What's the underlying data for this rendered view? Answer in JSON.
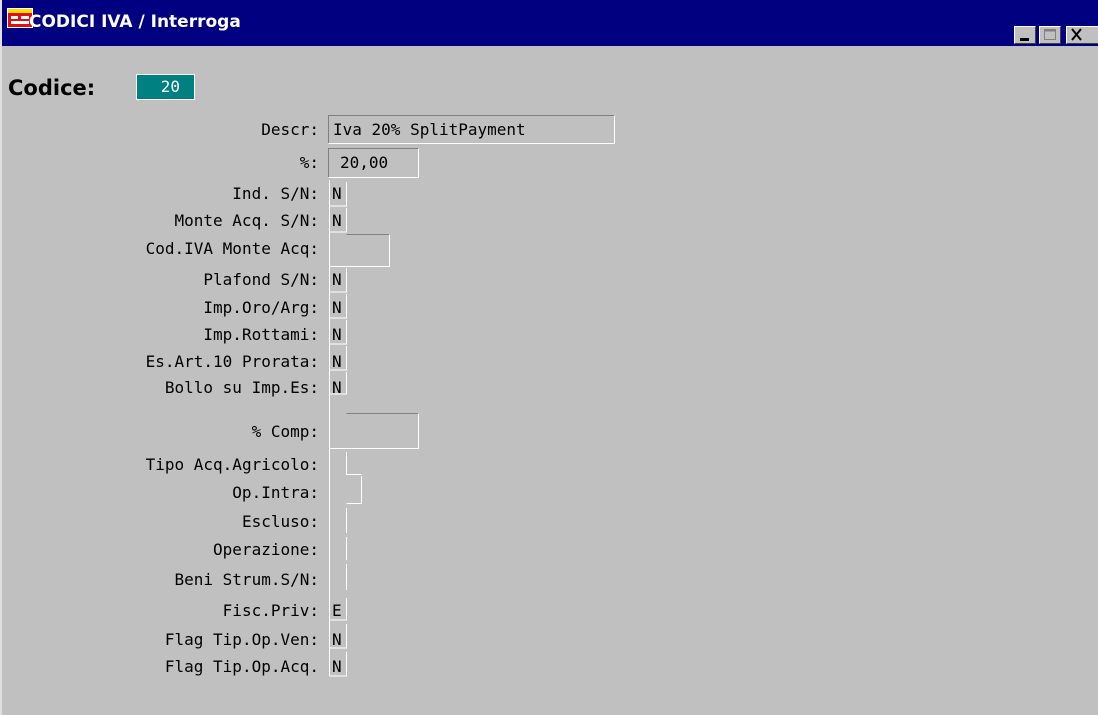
{
  "window": {
    "title": "CODICI IVA / Interroga"
  },
  "header": {
    "codice_label": "Codice:",
    "codice_value": "20"
  },
  "fields": [
    {
      "label": "Descr:",
      "value": "Iva 20% SplitPayment"
    },
    {
      "label": "%:",
      "value": "20,00"
    },
    {
      "label": "Ind. S/N:",
      "value": "N"
    },
    {
      "label": "Monte Acq. S/N:",
      "value": "N"
    },
    {
      "label": "Cod.IVA Monte Acq:",
      "value": ""
    },
    {
      "label": "Plafond S/N:",
      "value": "N"
    },
    {
      "label": "Imp.Oro/Arg:",
      "value": "N"
    },
    {
      "label": "Imp.Rottami:",
      "value": "N"
    },
    {
      "label": "Es.Art.10 Prorata:",
      "value": "N"
    },
    {
      "label": "Bollo su Imp.Es:",
      "value": "N"
    },
    {
      "label": "% Comp:",
      "value": ""
    },
    {
      "label": "Tipo Acq.Agricolo:",
      "value": ""
    },
    {
      "label": "Op.Intra:",
      "value": ""
    },
    {
      "label": "Escluso:",
      "value": ""
    },
    {
      "label": "Operazione:",
      "value": ""
    },
    {
      "label": "Beni Strum.S/N:",
      "value": ""
    },
    {
      "label": "Fisc.Priv:",
      "value": "E"
    },
    {
      "label": "Flag Tip.Op.Ven:",
      "value": "N"
    },
    {
      "label": "Flag Tip.Op.Acq.",
      "value": "N"
    }
  ],
  "icons": {
    "app": "app-window-icon",
    "minimize": "minimize-icon",
    "maximize": "maximize-icon",
    "close": "close-icon"
  },
  "colors": {
    "titlebar": "#000080",
    "background": "#c0c0c0",
    "codice_field": "#008080",
    "field_border": "#ffffff"
  }
}
